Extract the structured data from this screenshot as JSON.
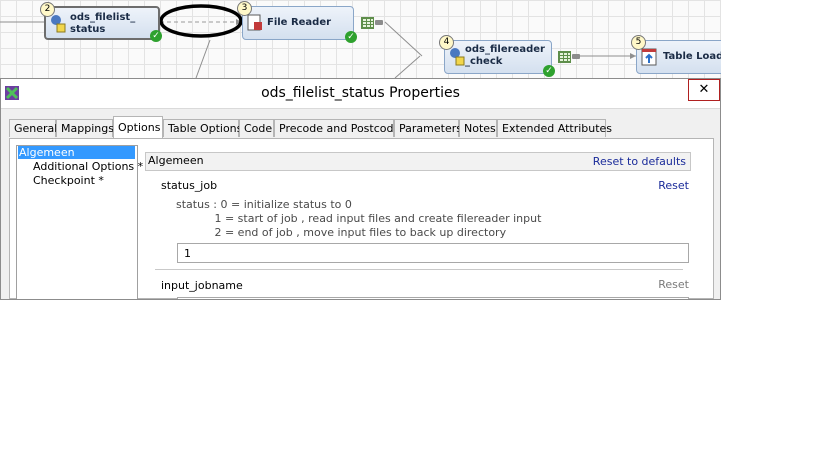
{
  "flow": {
    "nodes": [
      {
        "id": "n2",
        "number": "2",
        "label": "ods_filelist_\nstatus"
      },
      {
        "id": "n3",
        "number": "3",
        "label": "File Reader"
      },
      {
        "id": "n4",
        "number": "4",
        "label": "ods_filereader\n_check"
      },
      {
        "id": "n5",
        "number": "5",
        "label": "Table Loade"
      }
    ]
  },
  "dialog": {
    "title": "ods_filelist_status Properties",
    "close_glyph": "✕",
    "tabs": [
      {
        "label": "General"
      },
      {
        "label": "Mappings"
      },
      {
        "label": "Options"
      },
      {
        "label": "Table Options"
      },
      {
        "label": "Code"
      },
      {
        "label": "Precode and Postcode"
      },
      {
        "label": "Parameters"
      },
      {
        "label": "Notes"
      },
      {
        "label": "Extended Attributes"
      }
    ],
    "active_tab": "Options",
    "tree": [
      {
        "label": "Algemeen"
      },
      {
        "label": "Additional Options *"
      },
      {
        "label": "Checkpoint *"
      }
    ],
    "panel": {
      "header": "Algemeen",
      "reset_all": "Reset to defaults",
      "options": [
        {
          "label": "status_job",
          "reset": "Reset",
          "description": "status : 0 = initialize status to 0\n           1 = start of job , read input files and create filereader input\n           2 = end of job , move input files to back up directory",
          "value": "1"
        },
        {
          "label": "input_jobname",
          "reset": "Reset",
          "description": "",
          "value": ""
        }
      ]
    }
  },
  "colors": {
    "link": "#1a2b9a",
    "selection": "#3399ff",
    "close_border": "#b02020",
    "status_ok": "#2ea12e"
  }
}
